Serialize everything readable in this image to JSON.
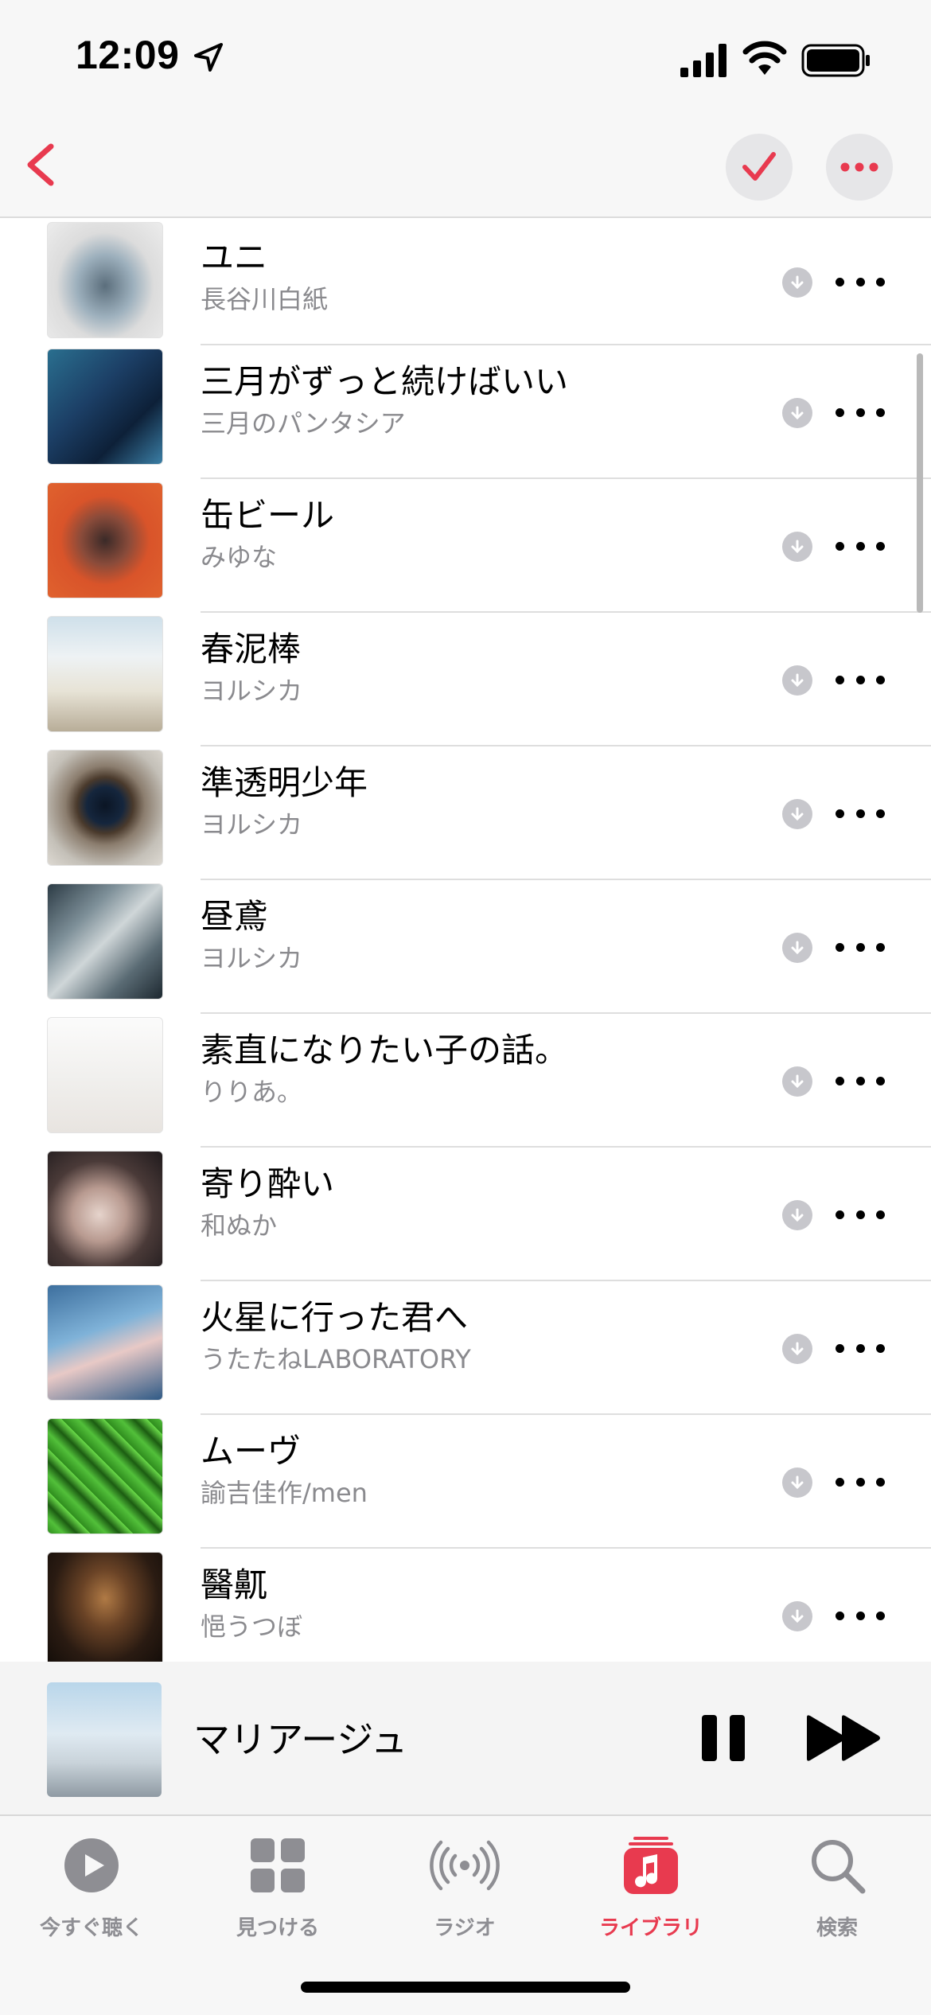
{
  "status_bar": {
    "time": "12:09"
  },
  "colors": {
    "accent": "#e83a4f",
    "secondary_text": "#8a8a8e",
    "separator": "#dedede"
  },
  "songs": [
    {
      "title": "ユニ",
      "artist": "長谷川白紙",
      "art_icon": "vase-artwork"
    },
    {
      "title": "三月がずっと続けばいい",
      "artist": "三月のパンタシア",
      "art_icon": "blue-illustration-artwork"
    },
    {
      "title": "缶ビール",
      "artist": "みゆな",
      "art_icon": "orange-portrait-artwork"
    },
    {
      "title": "春泥棒",
      "artist": "ヨルシカ",
      "art_icon": "pale-landscape-artwork"
    },
    {
      "title": "準透明少年",
      "artist": "ヨルシカ",
      "art_icon": "eye-artwork"
    },
    {
      "title": "昼鳶",
      "artist": "ヨルシカ",
      "art_icon": "collage-artwork"
    },
    {
      "title": "素直になりたい子の話。",
      "artist": "りりあ。",
      "art_icon": "couple-illustration-artwork"
    },
    {
      "title": "寄り酔い",
      "artist": "和ぬか",
      "art_icon": "girl-face-artwork"
    },
    {
      "title": "火星に行った君へ",
      "artist": "うたたねLABORATORY",
      "art_icon": "astronaut-artwork"
    },
    {
      "title": "ムーヴ",
      "artist": "諭吉佳作/men",
      "art_icon": "green-glitch-artwork"
    },
    {
      "title": "醫鼿",
      "artist": "悒うつぼ",
      "art_icon": "dark-room-artwork"
    }
  ],
  "now_playing": {
    "title": "マリアージュ",
    "art_icon": "antenna-sky-artwork"
  },
  "tabs": [
    {
      "label": "今すぐ聴く",
      "icon": "play-circle-icon",
      "active": false
    },
    {
      "label": "見つける",
      "icon": "grid-icon",
      "active": false
    },
    {
      "label": "ラジオ",
      "icon": "radio-waves-icon",
      "active": false
    },
    {
      "label": "ライブラリ",
      "icon": "music-note-icon",
      "active": true
    },
    {
      "label": "検索",
      "icon": "search-icon",
      "active": false
    }
  ]
}
